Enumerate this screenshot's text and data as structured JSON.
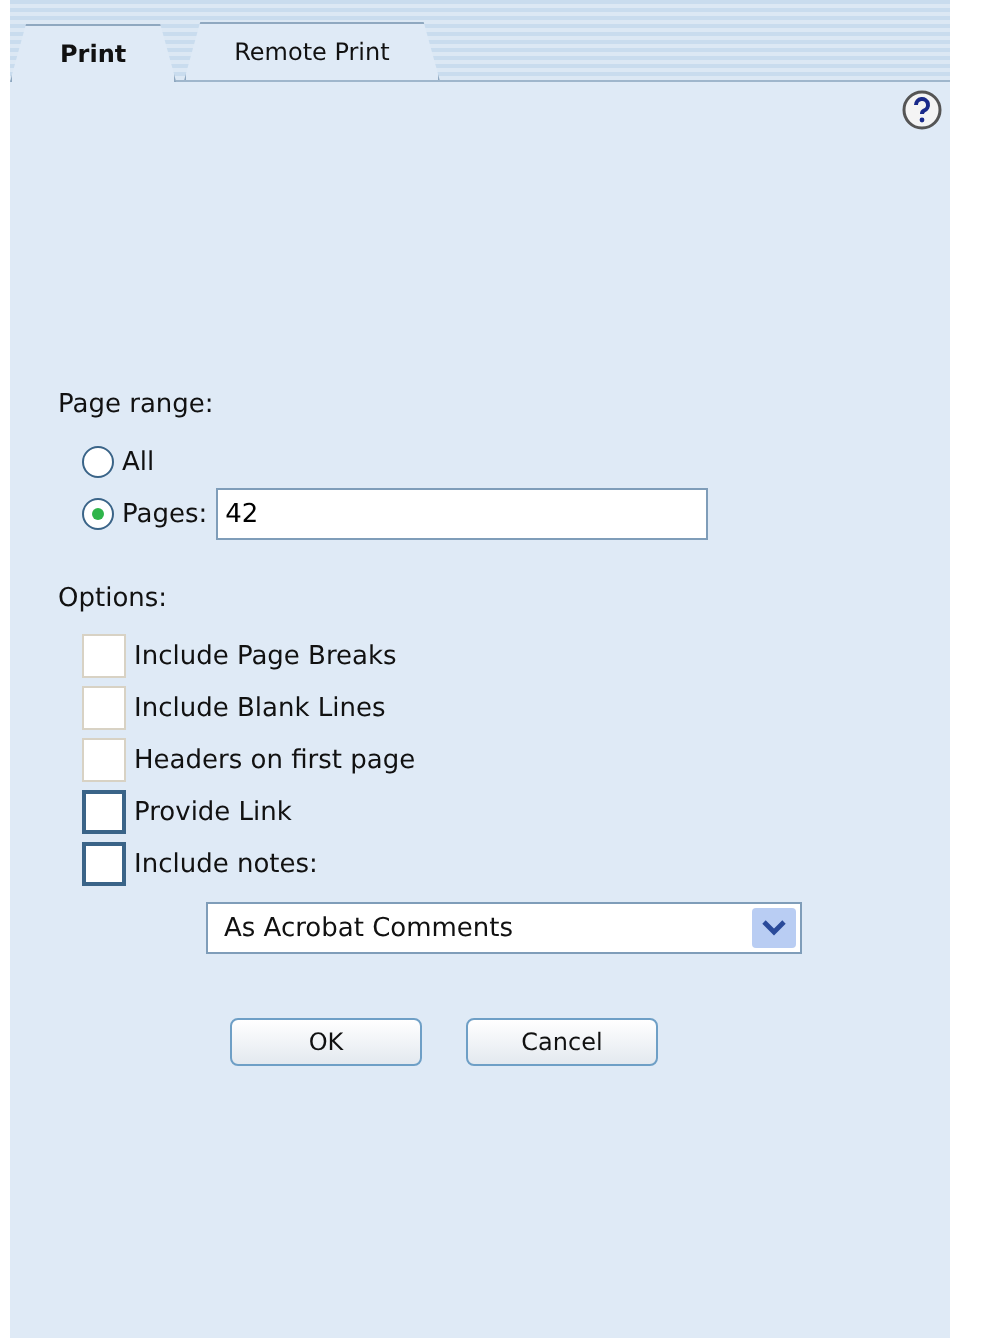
{
  "tabs": [
    {
      "label": "Print",
      "selected": true
    },
    {
      "label": "Remote Print",
      "selected": false
    }
  ],
  "page_range": {
    "label": "Page range:",
    "options": [
      {
        "label": "All",
        "selected": false
      },
      {
        "label": "Pages:",
        "selected": true
      }
    ],
    "pages_value": "42"
  },
  "options": {
    "label": "Options:",
    "items": [
      {
        "label": "Include Page Breaks",
        "checked": false,
        "disabled": true
      },
      {
        "label": "Include Blank Lines",
        "checked": false,
        "disabled": true
      },
      {
        "label": "Headers on first page",
        "checked": false,
        "disabled": true
      },
      {
        "label": "Provide Link",
        "checked": false,
        "disabled": false
      },
      {
        "label": "Include notes:",
        "checked": false,
        "disabled": false
      }
    ],
    "notes_select": "As Acrobat Comments"
  },
  "buttons": [
    "OK",
    "Cancel"
  ]
}
